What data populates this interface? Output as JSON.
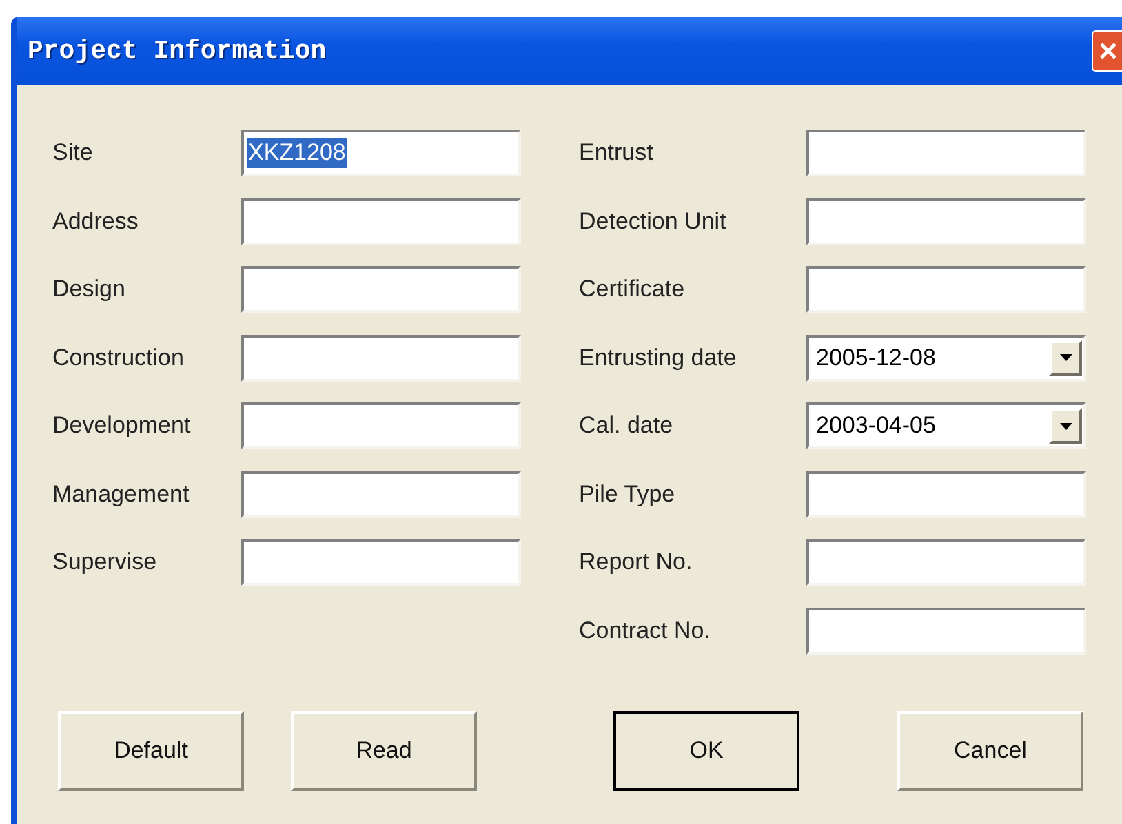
{
  "window": {
    "title": "Project Information"
  },
  "left_fields": [
    {
      "label": "Site",
      "kind": "text",
      "value": "XKZ1208",
      "highlighted": true
    },
    {
      "label": "Address",
      "kind": "text"
    },
    {
      "label": "Design",
      "kind": "text"
    },
    {
      "label": "Construction",
      "kind": "text"
    },
    {
      "label": "Development",
      "kind": "text"
    },
    {
      "label": "Management",
      "kind": "text"
    },
    {
      "label": "Supervise",
      "kind": "text"
    }
  ],
  "right_fields": [
    {
      "label": "Entrust",
      "kind": "text"
    },
    {
      "label": "Detection Unit",
      "kind": "text"
    },
    {
      "label": "Certificate",
      "kind": "text"
    },
    {
      "label": "Entrusting date",
      "kind": "date",
      "value": "2005-12-08"
    },
    {
      "label": "Cal. date",
      "kind": "date",
      "value": "2003-04-05"
    },
    {
      "label": "Pile Type",
      "kind": "text"
    },
    {
      "label": "Report No.",
      "kind": "text"
    },
    {
      "label": "Contract No.",
      "kind": "text"
    }
  ],
  "buttons": [
    {
      "label": "Default",
      "default": false
    },
    {
      "label": "Read",
      "default": false
    },
    {
      "label": "OK",
      "default": true
    },
    {
      "label": "Cancel",
      "default": false
    }
  ]
}
